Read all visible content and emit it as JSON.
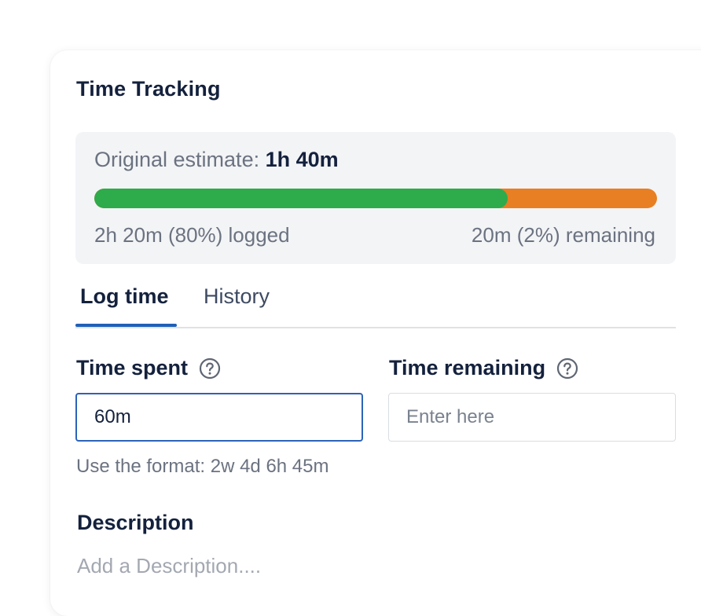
{
  "panel": {
    "title": "Time Tracking"
  },
  "estimate": {
    "label": "Original estimate:",
    "value": "1h 40m",
    "logged_text": "2h 20m (80%) logged",
    "remaining_text": "20m (2%) remaining",
    "progress_fraction": 0.734,
    "colors": {
      "logged": "#2eab4a",
      "remaining": "#e87f22"
    }
  },
  "tabs": [
    {
      "label": "Log time",
      "active": true
    },
    {
      "label": "History",
      "active": false
    }
  ],
  "form": {
    "time_spent": {
      "label": "Time spent",
      "value": "60m",
      "help_icon": "question-circle-icon"
    },
    "time_remaining": {
      "label": "Time remaining",
      "value": "",
      "placeholder": "Enter here",
      "help_icon": "question-circle-icon"
    },
    "hint": "Use the format: 2w 4d 6h 45m",
    "description": {
      "label": "Description",
      "placeholder": "Add a Description...."
    }
  }
}
